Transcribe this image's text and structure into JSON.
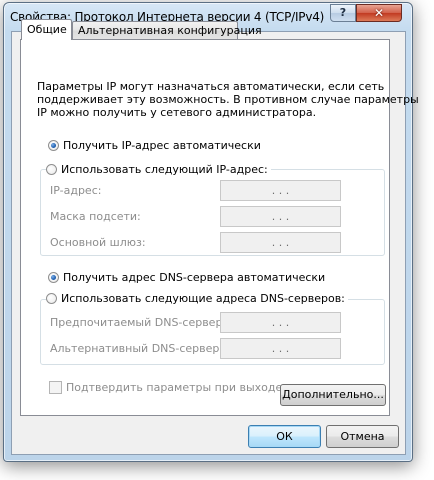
{
  "window": {
    "title": "Свойства: Протокол Интернета версии 4 (TCP/IPv4)",
    "help_label": "?",
    "close_label": "✕"
  },
  "tabs": [
    {
      "label": "Общие",
      "active": true
    },
    {
      "label": "Альтернативная конфигурация",
      "active": false
    }
  ],
  "description": [
    "Параметры IP могут назначаться автоматически, если сеть",
    "поддерживает эту возможность. В противном случае параметры",
    "IP можно получить у сетевого администратора."
  ],
  "ip": {
    "auto_label": "Получить IP-адрес автоматически",
    "auto_selected": true,
    "manual_label": "Использовать следующий IP-адрес:",
    "manual_selected": false,
    "fields": [
      {
        "label": "IP-адрес:",
        "value": ". . ."
      },
      {
        "label": "Маска подсети:",
        "value": ". . ."
      },
      {
        "label": "Основной шлюз:",
        "value": ". . ."
      }
    ]
  },
  "dns": {
    "auto_label": "Получить адрес DNS-сервера автоматически",
    "auto_selected": true,
    "manual_label": "Использовать следующие адреса DNS-серверов:",
    "manual_selected": false,
    "fields": [
      {
        "label": "Предпочитаемый DNS-сервер:",
        "value": ". . ."
      },
      {
        "label": "Альтернативный DNS-сервер:",
        "value": ". . ."
      }
    ]
  },
  "validate": {
    "label": "Подтвердить параметры при выходе",
    "checked": false
  },
  "buttons": {
    "advanced": "Дополнительно...",
    "ok": "ОК",
    "cancel": "Отмена"
  },
  "colors": {
    "window_frame": "#c4dbef",
    "close_button": "#c13a22",
    "disabled_text": "#8d8d8d"
  }
}
